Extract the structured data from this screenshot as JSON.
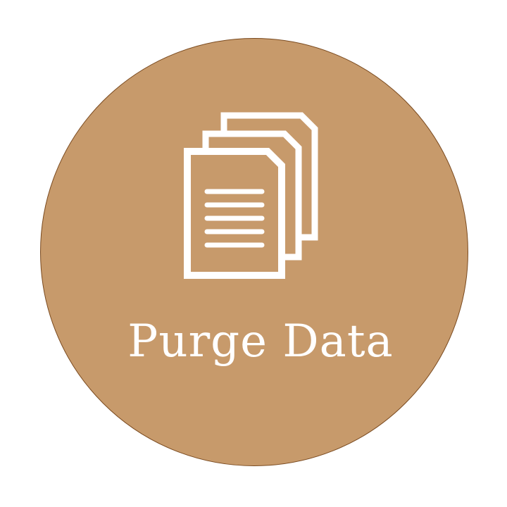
{
  "button": {
    "label": "Purge Data",
    "icon": "documents-stack-icon"
  },
  "colors": {
    "badge_fill": "#c79a6b",
    "badge_border": "#7a4a1f",
    "foreground": "#ffffff",
    "background": "#ffffff"
  }
}
